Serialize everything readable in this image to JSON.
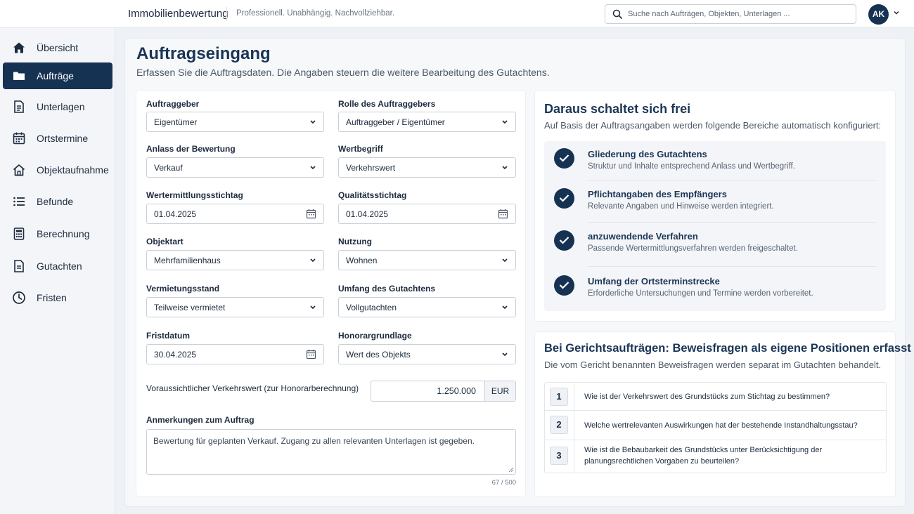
{
  "header": {
    "brand": "Immobilienbewertung",
    "tagline": "Professionell. Unabhängig. Nachvollziehbar.",
    "search_placeholder": "Suche nach Aufträgen, Objekten, Unterlagen ...",
    "avatar_initials": "AK"
  },
  "sidebar": {
    "items": [
      {
        "label": "Übersicht",
        "icon": "home-icon"
      },
      {
        "label": "Aufträge",
        "icon": "folder-icon",
        "active": true
      },
      {
        "label": "Unterlagen",
        "icon": "document-icon"
      },
      {
        "label": "Ortstermine",
        "icon": "calendar-icon"
      },
      {
        "label": "Objektaufnahme",
        "icon": "house-outline-icon"
      },
      {
        "label": "Befunde",
        "icon": "list-icon"
      },
      {
        "label": "Berechnung",
        "icon": "calculator-icon"
      },
      {
        "label": "Gutachten",
        "icon": "report-icon"
      },
      {
        "label": "Fristen",
        "icon": "clock-icon"
      }
    ]
  },
  "page": {
    "title": "Auftragseingang",
    "subtitle": "Erfassen Sie die Auftragsdaten. Die Angaben steuern die weitere Bearbeitung des Gutachtens."
  },
  "form": {
    "auftraggeber": {
      "label": "Auftraggeber",
      "value": "Eigentümer"
    },
    "rolle": {
      "label": "Rolle des Auftraggebers",
      "value": "Auftraggeber / Eigentümer"
    },
    "anlass": {
      "label": "Anlass der Bewertung",
      "value": "Verkauf"
    },
    "wertbegriff": {
      "label": "Wertbegriff",
      "value": "Verkehrswert"
    },
    "stichtag": {
      "label": "Wertermittlungsstichtag",
      "value": "01.04.2025"
    },
    "qualitaet": {
      "label": "Qualitätsstichtag",
      "value": "01.04.2025"
    },
    "objektart": {
      "label": "Objektart",
      "value": "Mehrfamilienhaus"
    },
    "nutzung": {
      "label": "Nutzung",
      "value": "Wohnen"
    },
    "vermietung": {
      "label": "Vermietungsstand",
      "value": "Teilweise vermietet"
    },
    "umfang": {
      "label": "Umfang des Gutachtens",
      "value": "Vollgutachten"
    },
    "frist": {
      "label": "Fristdatum",
      "value": "30.04.2025"
    },
    "honorar": {
      "label": "Honorargrundlage",
      "value": "Wert des Objekts"
    },
    "verkehrswert": {
      "label": "Voraussichtlicher Verkehrswert (zur Honorarberechnung)",
      "value": "1.250.000",
      "unit": "EUR"
    },
    "anmerkungen": {
      "label": "Anmerkungen zum Auftrag",
      "value": "Bewertung für geplanten Verkauf. Zugang zu allen relevanten Unterlagen ist gegeben.",
      "counter": "67 / 500"
    }
  },
  "unlock": {
    "title": "Daraus schaltet sich frei",
    "subtitle": "Auf Basis der Auftragsangaben werden folgende Bereiche automatisch konfiguriert:",
    "items": [
      {
        "title": "Gliederung des Gutachtens",
        "desc": "Struktur und Inhalte entsprechend Anlass und Wertbegriff."
      },
      {
        "title": "Pflichtangaben des Empfängers",
        "desc": "Relevante Angaben und Hinweise werden integriert."
      },
      {
        "title": "anzuwendende Verfahren",
        "desc": "Passende Wertermittlungsverfahren werden freigeschaltet."
      },
      {
        "title": "Umfang der Ortsterminstrecke",
        "desc": "Erforderliche Untersuchungen und Termine werden vorbereitet."
      }
    ]
  },
  "court": {
    "title": "Bei Gerichtsaufträgen: Beweisfragen als eigene Positionen erfasst",
    "subtitle": "Die vom Gericht benannten Beweisfragen werden separat im Gutachten behandelt.",
    "questions": [
      {
        "num": "1",
        "text": "Wie ist der Verkehrswert des Grundstücks zum Stichtag zu bestimmen?"
      },
      {
        "num": "2",
        "text": "Welche wertrelevanten Auswirkungen hat der bestehende Instandhaltungsstau?"
      },
      {
        "num": "3",
        "text": "Wie ist die Bebaubarkeit des Grundstücks unter Berücksichtigung der planungsrechtlichen Vorgaben zu beurteilen?"
      }
    ]
  },
  "colors": {
    "primary": "#163252",
    "title": "#1a3556",
    "background": "#eef1f5"
  }
}
